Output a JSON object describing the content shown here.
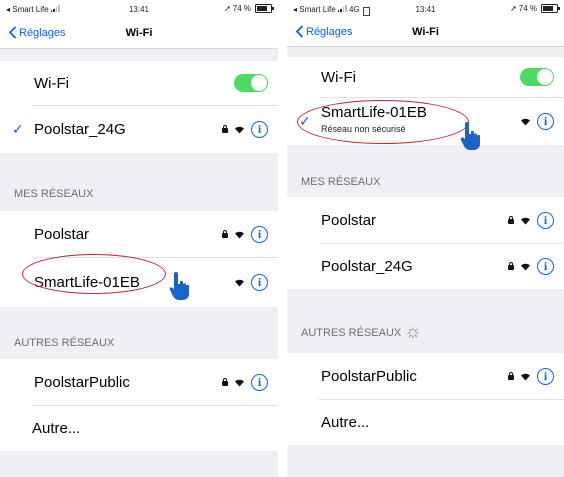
{
  "left": {
    "status": {
      "carrier": "◂ Smart Life",
      "time": "13:41",
      "battery": "74 %"
    },
    "nav": {
      "back": "Réglages",
      "title": "Wi-Fi"
    },
    "wifi_label": "Wi-Fi",
    "connected": {
      "name": "Poolstar_24G"
    },
    "my_networks_header": "MES RÉSEAUX",
    "my_networks": [
      {
        "name": "Poolstar"
      },
      {
        "name": "SmartLife-01EB"
      }
    ],
    "other_networks_header": "AUTRES RÉSEAUX",
    "other_networks": [
      {
        "name": "PoolstarPublic"
      }
    ],
    "other_label": "Autre..."
  },
  "right": {
    "status": {
      "carrier": "◂ Smart Life",
      "network": "4G",
      "time": "13:41",
      "battery": "74 %"
    },
    "nav": {
      "back": "Réglages",
      "title": "Wi-Fi"
    },
    "wifi_label": "Wi-Fi",
    "connected": {
      "name": "SmartLife-01EB",
      "subtitle": "Réseau non sécurisé"
    },
    "my_networks_header": "MES RÉSEAUX",
    "my_networks": [
      {
        "name": "Poolstar"
      },
      {
        "name": "Poolstar_24G"
      }
    ],
    "other_networks_header": "AUTRES RÉSEAUX",
    "other_networks": [
      {
        "name": "PoolstarPublic"
      }
    ],
    "other_label": "Autre..."
  },
  "colors": {
    "accent": "#0a60ff",
    "toggle_on": "#4cd964",
    "annotation": "#c0262d",
    "hand": "#1a63c9"
  },
  "icons": [
    "chevron-left-icon",
    "lock-icon",
    "wifi-icon",
    "info-icon",
    "toggle-switch",
    "pointing-hand-icon",
    "spinner-icon"
  ]
}
